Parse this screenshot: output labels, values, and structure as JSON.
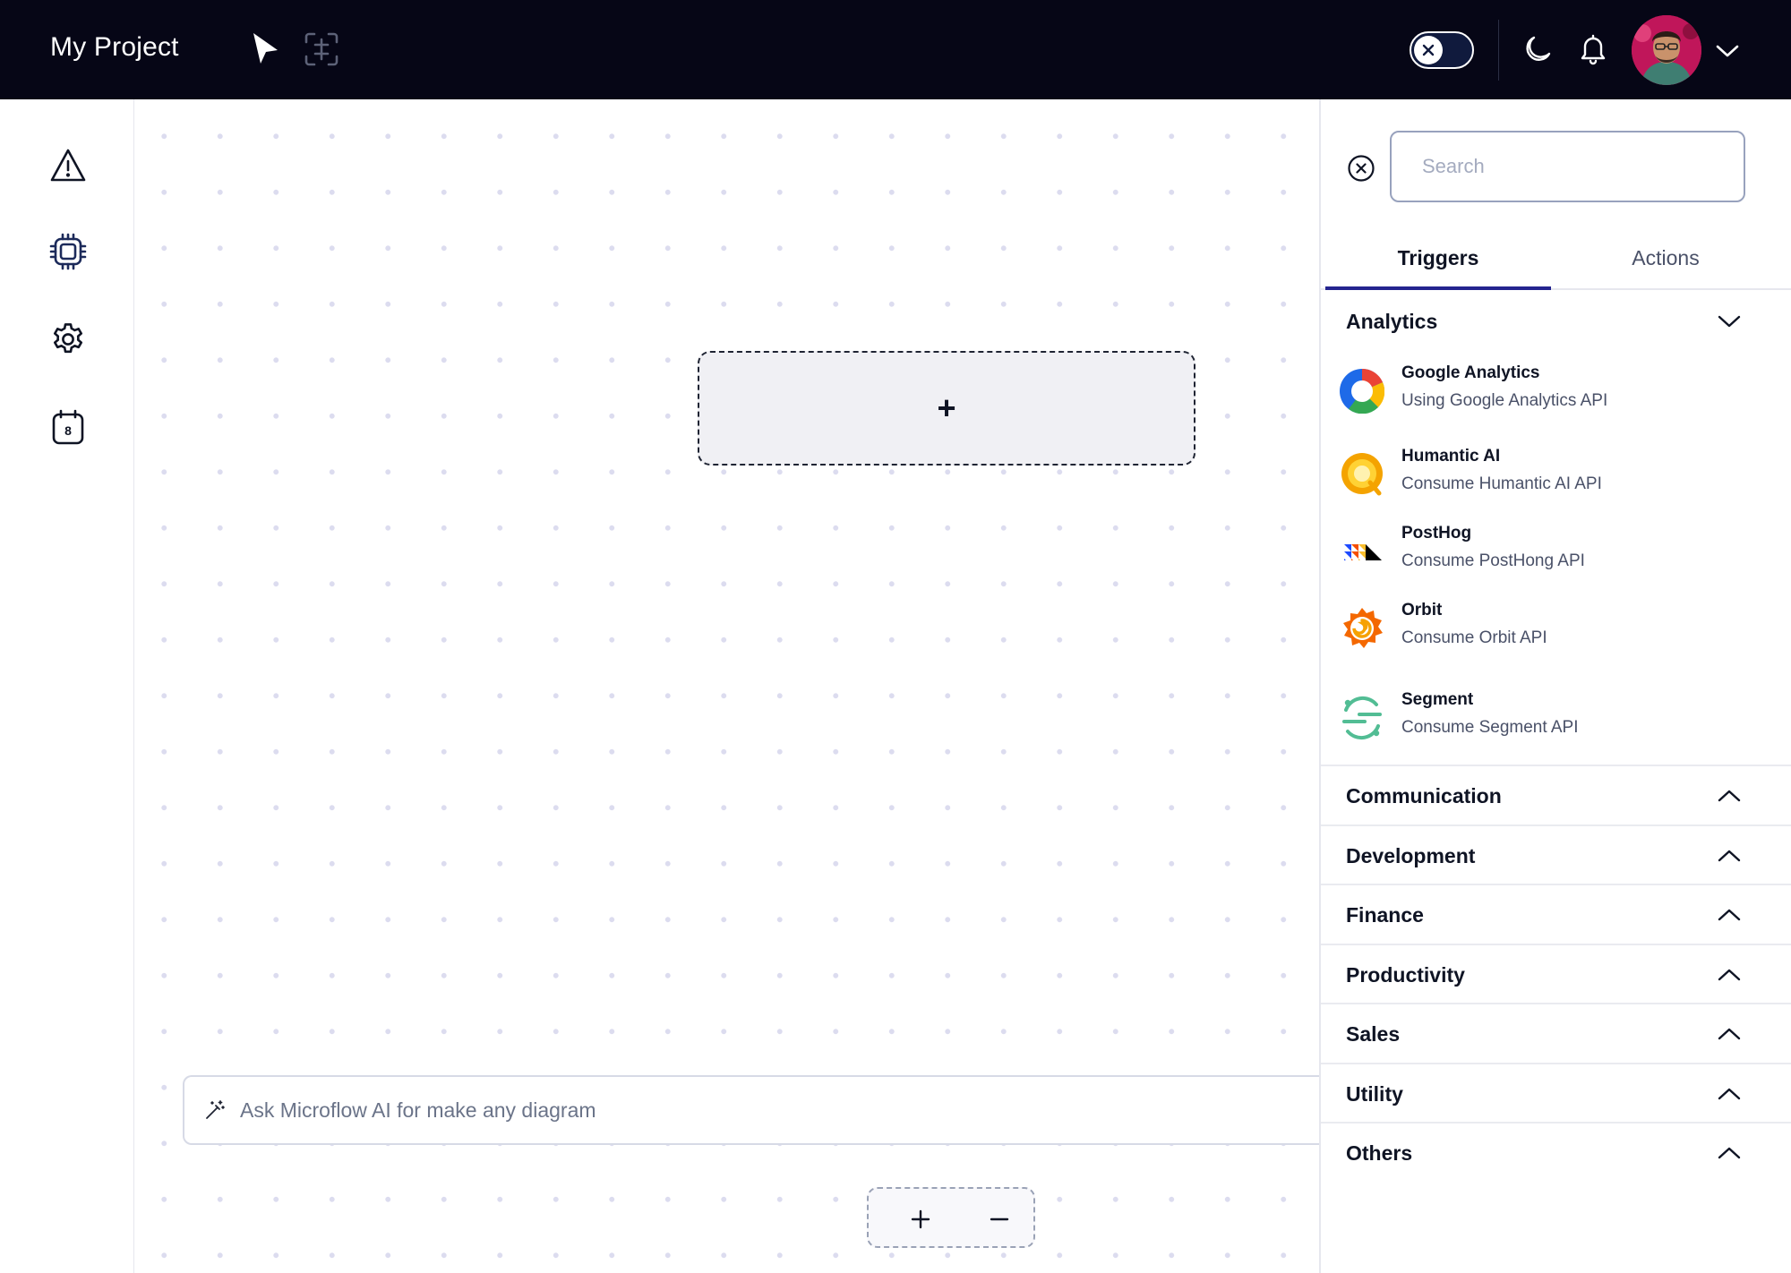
{
  "header": {
    "project_title": "My Project",
    "tools": [
      {
        "name": "pointer-icon"
      },
      {
        "name": "frame-select-icon"
      }
    ],
    "theme_toggle": {
      "icon": "close-icon",
      "state": "off"
    },
    "icons": [
      "moon-icon",
      "bell-icon",
      "chevron-down-icon"
    ]
  },
  "sidebar": {
    "items": [
      {
        "icon": "warning-icon"
      },
      {
        "icon": "chip-icon"
      },
      {
        "icon": "gear-icon"
      },
      {
        "icon": "calendar-icon",
        "badge": "8"
      }
    ]
  },
  "canvas": {
    "add_node_symbol": "+",
    "ai_prompt_placeholder": "Ask Microflow AI for make any diagram",
    "ai_icon": "magic-wand-icon",
    "zoom": {
      "in": "+",
      "out": "−"
    }
  },
  "panel": {
    "search_placeholder": "Search",
    "search_value": "",
    "tabs": [
      {
        "label": "Triggers",
        "active": true
      },
      {
        "label": "Actions",
        "active": false
      }
    ],
    "categories": [
      {
        "name": "Analytics",
        "expanded": true,
        "items": [
          {
            "name": "Google Analytics",
            "desc": "Using Google Analytics API",
            "logo": "google-analytics-logo"
          },
          {
            "name": "Humantic AI",
            "desc": "Consume Humantic AI API",
            "logo": "humantic-ai-logo"
          },
          {
            "name": "PostHog",
            "desc": "Consume PostHong API",
            "logo": "posthog-logo"
          },
          {
            "name": "Orbit",
            "desc": "Consume Orbit API",
            "logo": "orbit-logo"
          },
          {
            "name": "Segment",
            "desc": "Consume Segment API",
            "logo": "segment-logo"
          }
        ]
      },
      {
        "name": "Communication",
        "expanded": false
      },
      {
        "name": "Development",
        "expanded": false
      },
      {
        "name": "Finance",
        "expanded": false
      },
      {
        "name": "Productivity",
        "expanded": false
      },
      {
        "name": "Sales",
        "expanded": false
      },
      {
        "name": "Utility",
        "expanded": false
      },
      {
        "name": "Others",
        "expanded": false
      }
    ]
  },
  "colors": {
    "topbar_bg": "#060616",
    "accent": "#24248f",
    "text_primary": "#0f1424",
    "text_secondary": "#4a5168"
  }
}
